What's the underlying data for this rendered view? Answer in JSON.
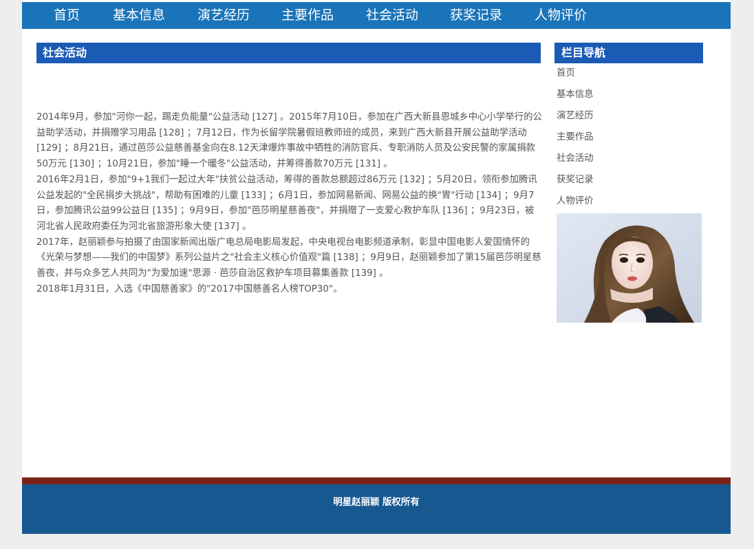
{
  "nav": {
    "items": [
      {
        "label": "首页"
      },
      {
        "label": "基本信息"
      },
      {
        "label": "演艺经历"
      },
      {
        "label": "主要作品"
      },
      {
        "label": "社会活动"
      },
      {
        "label": "获奖记录"
      },
      {
        "label": "人物评价"
      }
    ]
  },
  "main": {
    "heading": "社会活动",
    "paragraphs": [
      "2014年9月，参加\"河你一起，踢走负能量\"公益活动 [127] 。2015年7月10日，参加在广西大新县恩城乡中心小学举行的公益助学活动，并捐赠学习用品 [128] ；7月12日，作为长留学院暑假班教师班的成员，来到广西大新县开展公益助学活动 [129] ；8月21日，通过芭莎公益慈善基金向在8.12天津爆炸事故中牺牲的消防官兵、专职消防人员及公安民警的家属捐款50万元 [130] ；10月21日，参加\"睡一个暖冬\"公益活动，并筹得善款70万元 [131] 。",
      "2016年2月1日，参加\"9+1我们一起过大年\"扶贫公益活动，筹得的善款总额超过86万元 [132] ；5月20日，领衔参加腾讯公益发起的\"全民捐步大挑战\"，帮助有困难的儿童 [133] ；6月1日，参加网易新闻、网易公益的换\"胃\"行动 [134] ；9月7日，参加腾讯公益99公益日 [135] ；9月9日，参加\"芭莎明星慈善夜\"，并捐赠了一支爱心救护车队 [136] ；9月23日，被河北省人民政府委任为河北省旅游形象大使 [137] 。",
      "2017年，赵丽颖参与拍摄了由国家新闻出版广电总局电影局发起，中央电视台电影频道承制，彰显中国电影人爱国情怀的《光荣与梦想——我们的中国梦》系列公益片之\"社会主义核心价值观\"篇 [138] ；9月9日，赵丽颖参加了第15届芭莎明星慈善夜，并与众多艺人共同为\"为爱加速\"思源 · 芭莎自治区救护车项目募集善款 [139] 。",
      "2018年1月31日，入选《中国慈善家》的\"2017中国慈善名人榜TOP30\"。"
    ]
  },
  "sidebar": {
    "heading": "栏目导航",
    "items": [
      {
        "label": "首页"
      },
      {
        "label": "基本信息"
      },
      {
        "label": "演艺经历"
      },
      {
        "label": "主要作品"
      },
      {
        "label": "社会活动"
      },
      {
        "label": "获奖记录"
      },
      {
        "label": "人物评价"
      }
    ]
  },
  "footer": {
    "copyright": "明星赵丽颖 版权所有"
  },
  "colors": {
    "nav_bar": "#1a74b9",
    "heading_bar": "#1b5bb5",
    "footer_stripe": "#7a2418",
    "footer": "#175891"
  }
}
